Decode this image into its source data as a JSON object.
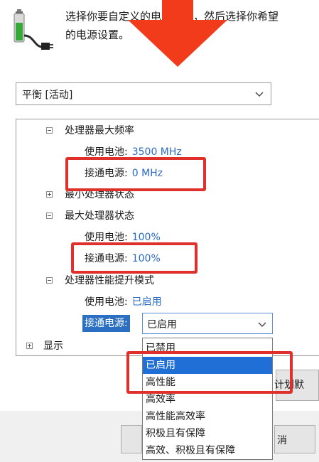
{
  "header": {
    "line1": "选择你要自定义的电源计划，然后选择你希望",
    "line2": "的电源设置。"
  },
  "plan": {
    "selected": "平衡 [活动]"
  },
  "tree": {
    "max_freq": {
      "title": "处理器最大频率",
      "battery_label": "使用电池:",
      "battery_value": "3500 MHz",
      "plugged_label": "接通电源:",
      "plugged_value": "0 MHz"
    },
    "min_state": {
      "title": "最小处理器状态"
    },
    "max_state": {
      "title": "最大处理器状态",
      "battery_label": "使用电池:",
      "battery_value": "100%",
      "plugged_label": "接通电源:",
      "plugged_value": "100%"
    },
    "boost": {
      "title": "处理器性能提升模式",
      "battery_label": "使用电池:",
      "battery_value": "已启用",
      "plugged_label": "接通电源:",
      "plugged_value": "已启用"
    },
    "display": {
      "title": "显示"
    }
  },
  "dropdown_options": [
    "已禁用",
    "已启用",
    "高性能",
    "高效率",
    "高性能高效率",
    "积极且有保障",
    "高效、积极且有保障"
  ],
  "buttons": {
    "restore_partial": "计划默",
    "cancel_partial": "消"
  },
  "colors": {
    "accent": "#2b6fc2",
    "highlight": "#e0302c",
    "value_blue": "#2a6ac4"
  }
}
